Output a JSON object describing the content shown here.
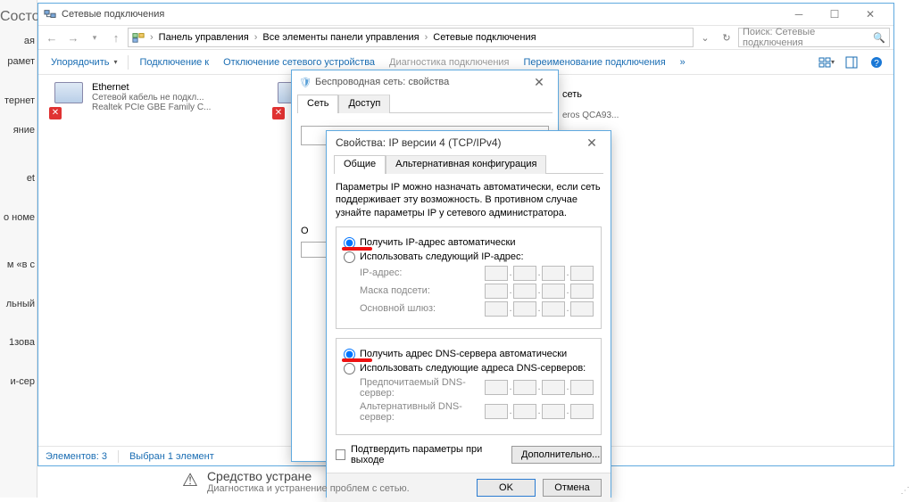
{
  "left_panel": {
    "header": "Состояние",
    "items": [
      "ая",
      "рамет",
      "тернет",
      "яние",
      "et",
      "о номе",
      "м «в с",
      "льный",
      "1зова",
      "и-сер"
    ]
  },
  "explorer": {
    "title": "Сетевые подключения",
    "nav": {
      "back": "←",
      "forward": "→",
      "up": "↑"
    },
    "breadcrumb": [
      "Панель управления",
      "Все элементы панели управления",
      "Сетевые подключения"
    ],
    "refresh_hint": "↻",
    "search_placeholder": "Поиск: Сетевые подключения",
    "commands": {
      "organize": "Упорядочить",
      "connect": "Подключение к",
      "disable": "Отключение сетевого устройства",
      "diagnose": "Диагностика подключения",
      "rename": "Переименование подключения"
    },
    "adapters": {
      "ethernet": {
        "name": "Ethernet",
        "line2": "Сетевой кабель не подкл...",
        "line3": "Realtek PCIe GBE Family C..."
      },
      "wifi": {
        "name": "сеть",
        "line2": "eros QCA93..."
      }
    },
    "status": {
      "count_label": "Элементов: 3",
      "selected_label": "Выбран 1 элемент"
    }
  },
  "dlg_wifi": {
    "title": "Беспроводная сеть: свойства",
    "tabs": {
      "network": "Сеть",
      "access": "Доступ"
    },
    "o_label": "О"
  },
  "dlg_ipv4": {
    "title": "Свойства: IP версии 4 (TCP/IPv4)",
    "tabs": {
      "general": "Общие",
      "alt": "Альтернативная конфигурация"
    },
    "intro": "Параметры IP можно назначать автоматически, если сеть поддерживает эту возможность. В противном случае узнайте параметры IP у сетевого администратора.",
    "ip_auto": "Получить IP-адрес автоматически",
    "ip_manual": "Использовать следующий IP-адрес:",
    "ip_label": "IP-адрес:",
    "mask_label": "Маска подсети:",
    "gw_label": "Основной шлюз:",
    "dns_auto": "Получить адрес DNS-сервера автоматически",
    "dns_manual": "Использовать следующие адреса DNS-серверов:",
    "dns1_label": "Предпочитаемый DNS-сервер:",
    "dns2_label": "Альтернативный DNS-сервер:",
    "confirm": "Подтвердить параметры при выходе",
    "advanced": "Дополнительно...",
    "ok": "OK",
    "cancel": "Отмена"
  },
  "troubleshooter": {
    "line1": "Средство устране",
    "line2": "Диагностика и устранение проблем с сетью."
  }
}
